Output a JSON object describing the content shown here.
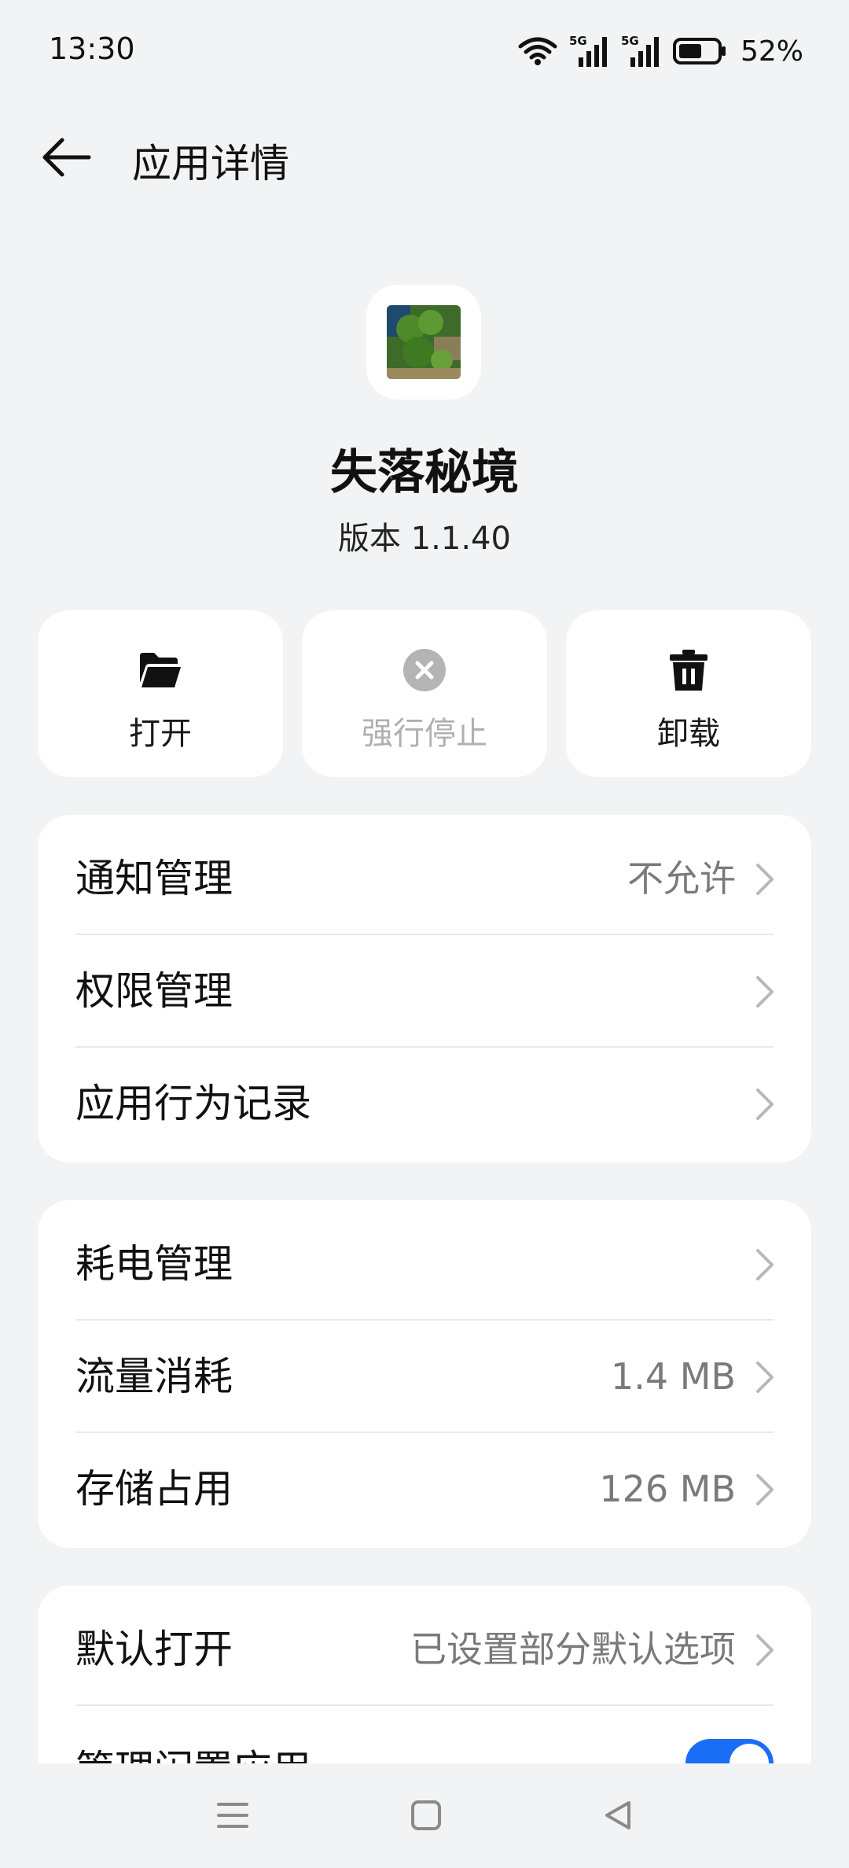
{
  "status_bar": {
    "time": "13:30",
    "battery_percent": "52%",
    "network_labels": [
      "5G",
      "5G"
    ],
    "icons": [
      "wifi-icon",
      "signal-5g-icon",
      "signal-5g-icon",
      "battery-icon"
    ]
  },
  "header": {
    "title": "应用详情",
    "back_icon": "back-arrow-icon"
  },
  "app": {
    "name": "失落秘境",
    "version": "版本 1.1.40"
  },
  "actions": [
    {
      "label": "打开",
      "icon": "folder-open-icon",
      "enabled": true
    },
    {
      "label": "强行停止",
      "icon": "close-circle-icon",
      "enabled": false
    },
    {
      "label": "卸载",
      "icon": "trash-icon",
      "enabled": true
    }
  ],
  "card1": [
    {
      "label": "通知管理",
      "value": "不允许"
    },
    {
      "label": "权限管理",
      "value": ""
    },
    {
      "label": "应用行为记录",
      "value": ""
    }
  ],
  "card2": [
    {
      "label": "耗电管理",
      "value": ""
    },
    {
      "label": "流量消耗",
      "value": "1.4 MB"
    },
    {
      "label": "存储占用",
      "value": "126 MB"
    }
  ],
  "card3": [
    {
      "label": "默认打开",
      "value": "已设置部分默认选项"
    },
    {
      "label": "管理闲置应用",
      "toggle_on": true
    }
  ],
  "colors": {
    "background": "#f1f3f5",
    "accent": "#1a6ef5",
    "secondary_text": "#7a7a7a"
  },
  "nav_bar": {
    "icons": [
      "menu-icon",
      "home-icon",
      "back-triangle-icon"
    ]
  }
}
